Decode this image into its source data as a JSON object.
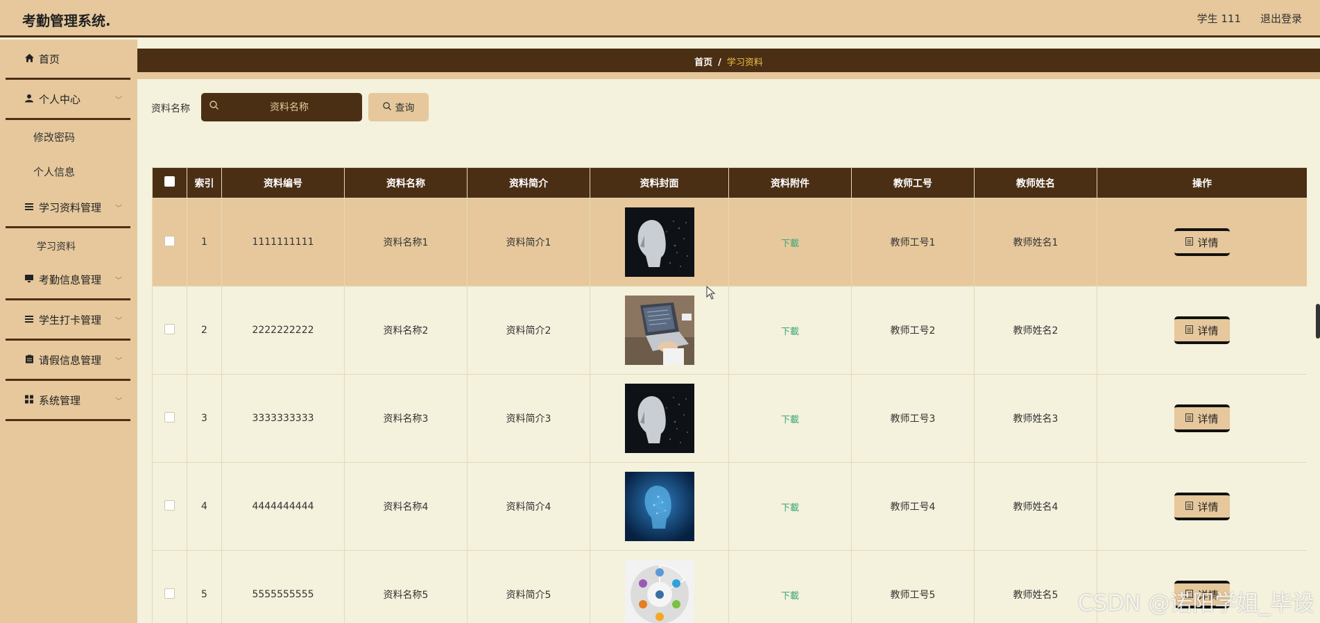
{
  "header": {
    "title": "考勤管理系统.",
    "user": "学生 111",
    "logout": "退出登录"
  },
  "sidebar": {
    "home": "首页",
    "personal_center": "个人中心",
    "change_password": "修改密码",
    "personal_info": "个人信息",
    "study_material_mgmt": "学习资料管理",
    "study_material": "学习资料",
    "attendance_mgmt": "考勤信息管理",
    "checkin_mgmt": "学生打卡管理",
    "leave_mgmt": "请假信息管理",
    "system_mgmt": "系统管理"
  },
  "breadcrumb": {
    "home": "首页",
    "separator": "/",
    "current": "学习资料"
  },
  "search": {
    "label": "资料名称",
    "placeholder": "资料名称",
    "button": "查询"
  },
  "table": {
    "columns": [
      "索引",
      "资料编号",
      "资料名称",
      "资料简介",
      "资料封面",
      "资料附件",
      "教师工号",
      "教师姓名",
      "操作"
    ],
    "rows": [
      {
        "index": "1",
        "code": "1111111111",
        "name": "资料名称1",
        "intro": "资料简介1",
        "cover": "ai-head-dark",
        "attachment": "下載",
        "teacher_no": "教师工号1",
        "teacher_name": "教师姓名1",
        "action": "详情"
      },
      {
        "index": "2",
        "code": "2222222222",
        "name": "资料名称2",
        "intro": "资料简介2",
        "cover": "laptop-typing",
        "attachment": "下載",
        "teacher_no": "教师工号2",
        "teacher_name": "教师姓名2",
        "action": "详情"
      },
      {
        "index": "3",
        "code": "3333333333",
        "name": "资料名称3",
        "intro": "资料简介3",
        "cover": "ai-head-dark",
        "attachment": "下載",
        "teacher_no": "教师工号3",
        "teacher_name": "教师姓名3",
        "action": "详情"
      },
      {
        "index": "4",
        "code": "4444444444",
        "name": "资料名称4",
        "intro": "资料简介4",
        "cover": "ai-head-blue",
        "attachment": "下載",
        "teacher_no": "教师工号4",
        "teacher_name": "教师姓名4",
        "action": "详情"
      },
      {
        "index": "5",
        "code": "5555555555",
        "name": "资料名称5",
        "intro": "资料简介5",
        "cover": "diagram-circle",
        "attachment": "下載",
        "teacher_no": "教师工号5",
        "teacher_name": "教师姓名5",
        "action": "详情"
      }
    ]
  },
  "watermark": "CSDN @诺阳学姐_毕设",
  "colors": {
    "brown": "#4a2f14",
    "tan": "#e6c89c",
    "cream": "#f4f1dc",
    "highlight": "#f0c048",
    "link": "#3aa77a"
  }
}
